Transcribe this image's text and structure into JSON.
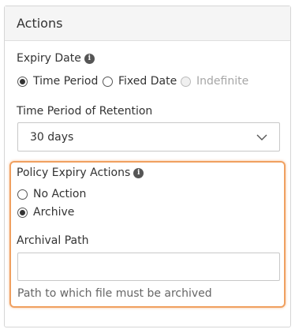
{
  "panel": {
    "title": "Actions"
  },
  "expiry_date": {
    "label": "Expiry Date",
    "info_icon": "info-icon",
    "options": [
      {
        "label": "Time Period",
        "checked": true,
        "disabled": false
      },
      {
        "label": "Fixed Date",
        "checked": false,
        "disabled": false
      },
      {
        "label": "Indefinite",
        "checked": false,
        "disabled": true
      }
    ]
  },
  "retention": {
    "label": "Time Period of Retention",
    "selected": "30 days",
    "chevron_icon": "chevron-down-icon"
  },
  "policy_expiry": {
    "label": "Policy Expiry Actions",
    "info_icon": "info-icon",
    "options": [
      {
        "label": "No Action",
        "checked": false
      },
      {
        "label": "Archive",
        "checked": true
      }
    ]
  },
  "archival_path": {
    "label": "Archival Path",
    "value": "",
    "placeholder": "",
    "help_text": "Path to which file must be archived"
  },
  "colors": {
    "highlight_border": "#f0a060",
    "header_bg": "#f5f5f5",
    "panel_border": "#d6d6d6"
  }
}
